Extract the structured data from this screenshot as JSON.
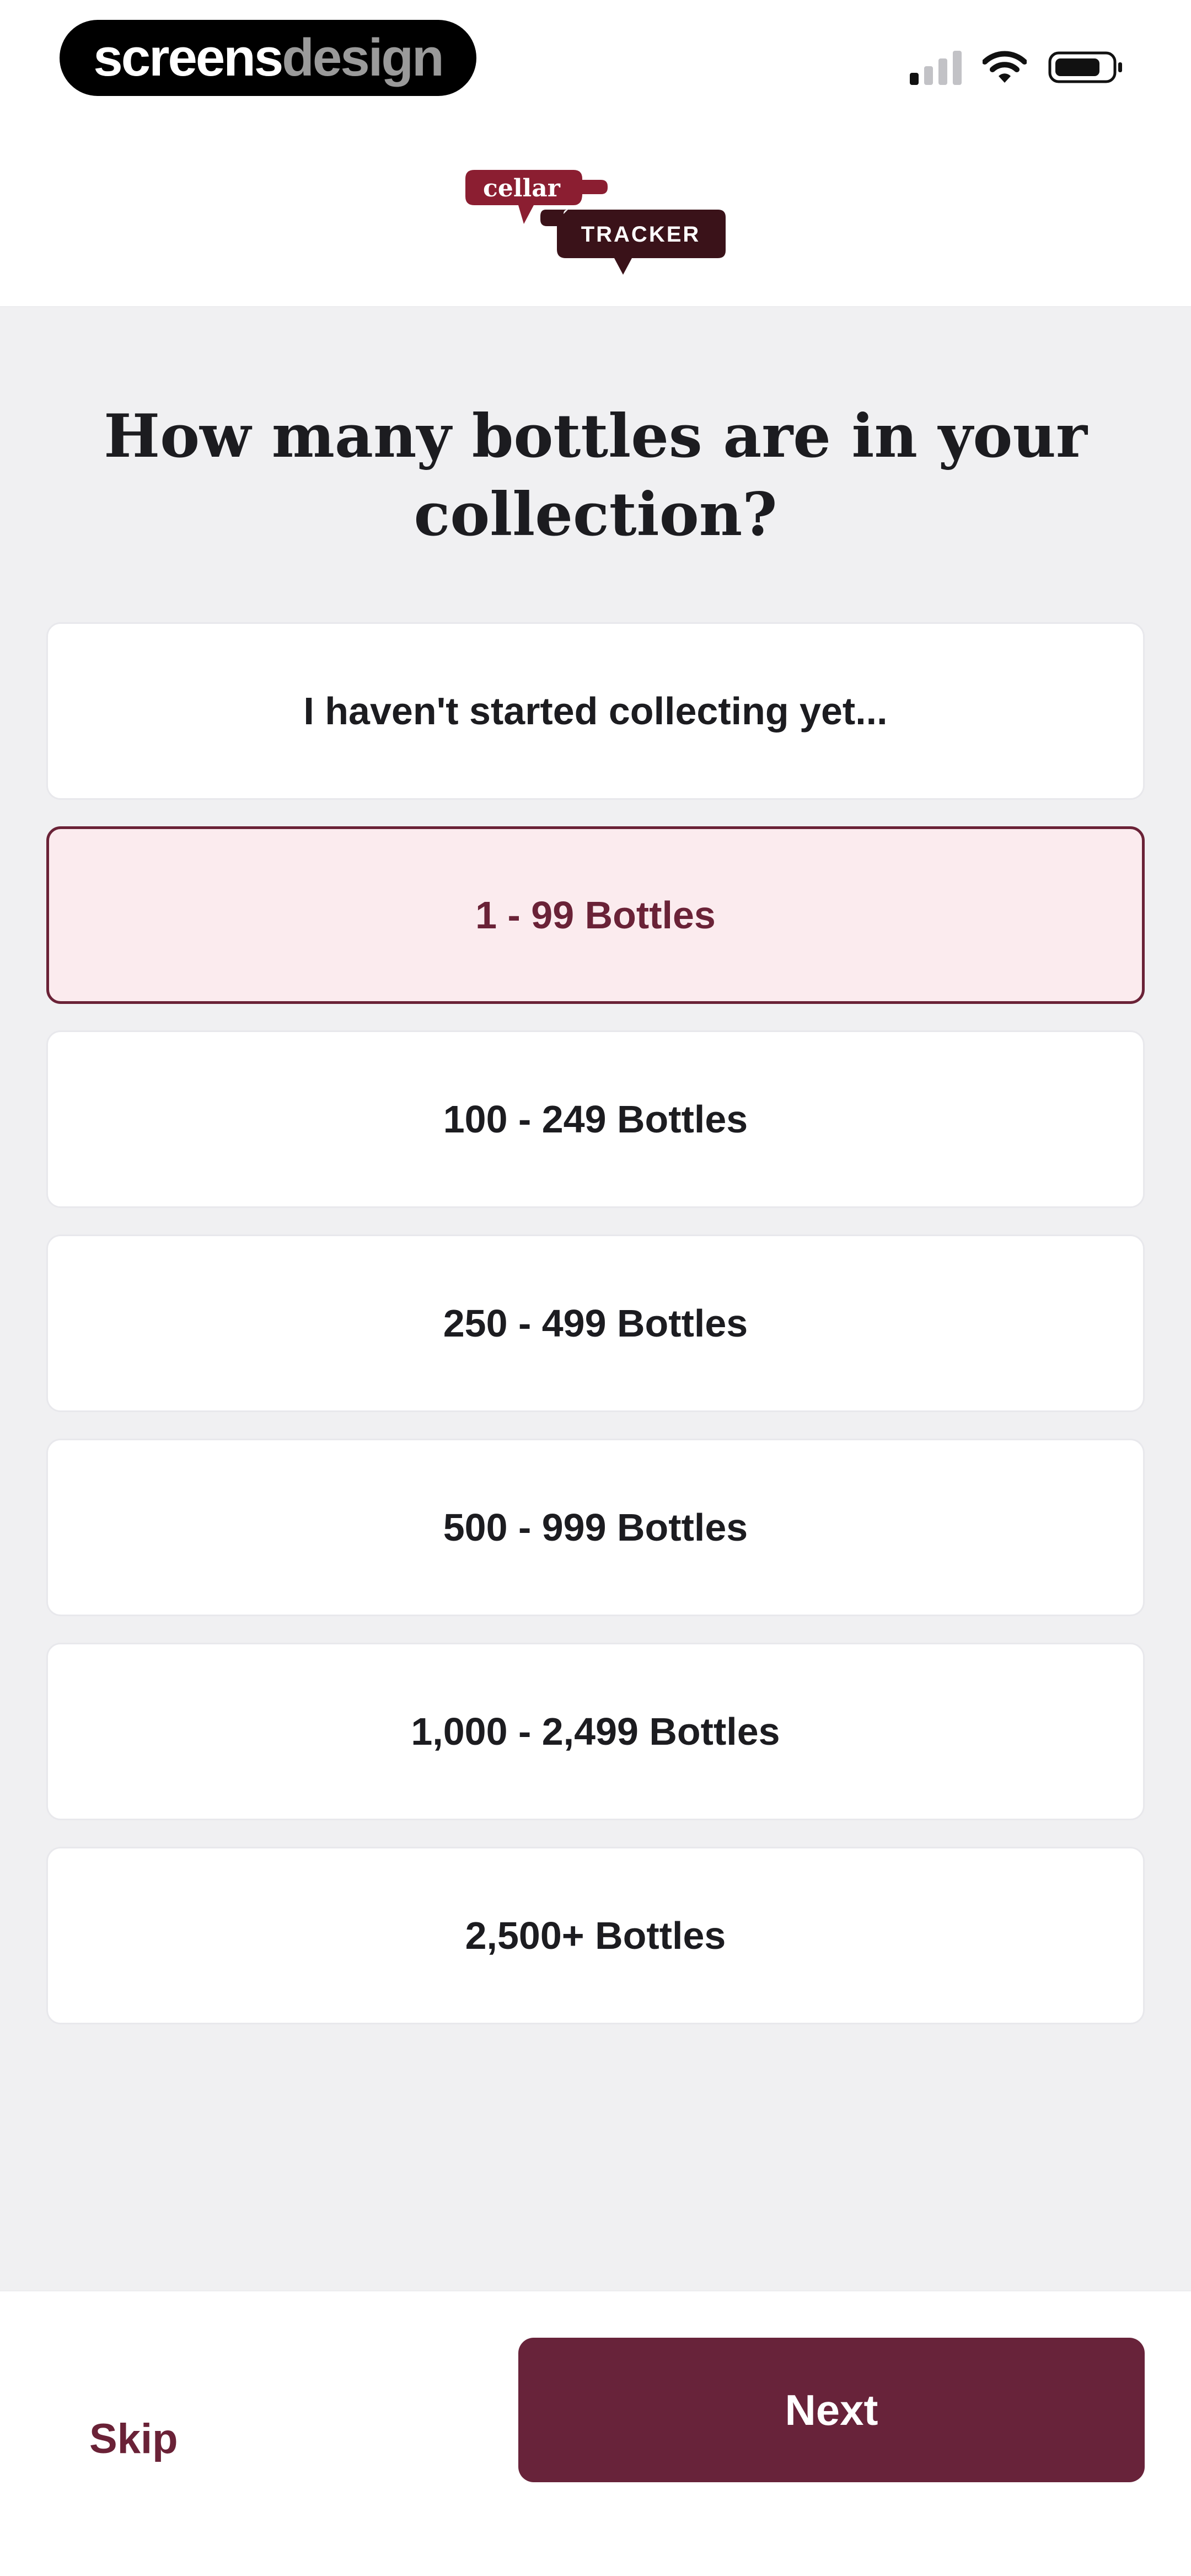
{
  "watermark": {
    "part1": "screens",
    "part2": "design"
  },
  "logo": {
    "top_text": "cellar",
    "bottom_text": "TRACKER"
  },
  "colors": {
    "brand": "#68233a",
    "selected_bg": "#fbebee",
    "background": "#f0f0f2"
  },
  "icons": [
    "signal-icon",
    "wifi-icon",
    "battery-icon"
  ],
  "question": "How many bottles are in your collection?",
  "options": [
    {
      "label": "I haven't started collecting yet...",
      "selected": false
    },
    {
      "label": "1 - 99 Bottles",
      "selected": true
    },
    {
      "label": "100 - 249 Bottles",
      "selected": false
    },
    {
      "label": "250 - 499 Bottles",
      "selected": false
    },
    {
      "label": "500 - 999 Bottles",
      "selected": false
    },
    {
      "label": "1,000 - 2,499 Bottles",
      "selected": false
    },
    {
      "label": "2,500+ Bottles",
      "selected": false
    }
  ],
  "footer": {
    "skip_label": "Skip",
    "next_label": "Next"
  }
}
